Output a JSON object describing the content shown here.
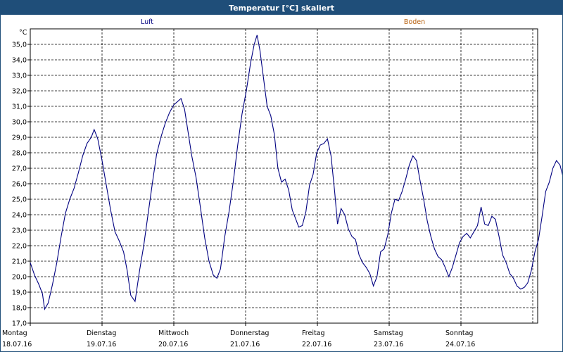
{
  "window": {
    "title": "Temperatur [°C] skaliert"
  },
  "chart_data": {
    "type": "line",
    "title": "Temperatur [°C] skaliert",
    "ylabel": "°C",
    "ylim": [
      17.0,
      36.0
    ],
    "grid": true,
    "y_ticks": [
      "17,0",
      "18,0",
      "19,0",
      "20,0",
      "21,0",
      "22,0",
      "23,0",
      "24,0",
      "25,0",
      "26,0",
      "27,0",
      "28,0",
      "29,0",
      "30,0",
      "31,0",
      "32,0",
      "33,0",
      "34,0",
      "35,0"
    ],
    "x_days": [
      {
        "day": "Montag",
        "date": "18.07.16"
      },
      {
        "day": "Dienstag",
        "date": "19.07.16"
      },
      {
        "day": "Mittwoch",
        "date": "20.07.16"
      },
      {
        "day": "Donnerstag",
        "date": "21.07.16"
      },
      {
        "day": "Freitag",
        "date": "22.07.16"
      },
      {
        "day": "Samstag",
        "date": "23.07.16"
      },
      {
        "day": "Sonntag",
        "date": "24.07.16"
      }
    ],
    "legend": [
      {
        "name": "Luft",
        "color": "#000080"
      },
      {
        "name": "Boden",
        "color": "#b8620f"
      }
    ],
    "series": [
      {
        "name": "Luft",
        "color": "#000080",
        "x_unit": "days since 18.07.16 00:00",
        "points": [
          [
            0.0,
            20.9
          ],
          [
            0.06,
            20.1
          ],
          [
            0.12,
            19.5
          ],
          [
            0.17,
            18.9
          ],
          [
            0.2,
            17.9
          ],
          [
            0.25,
            18.3
          ],
          [
            0.31,
            19.5
          ],
          [
            0.37,
            20.9
          ],
          [
            0.43,
            22.6
          ],
          [
            0.49,
            24.1
          ],
          [
            0.55,
            25.0
          ],
          [
            0.61,
            25.7
          ],
          [
            0.67,
            26.7
          ],
          [
            0.73,
            27.8
          ],
          [
            0.79,
            28.6
          ],
          [
            0.85,
            29.0
          ],
          [
            0.89,
            29.5
          ],
          [
            0.94,
            28.9
          ],
          [
            1.0,
            27.5
          ],
          [
            1.06,
            25.9
          ],
          [
            1.12,
            24.3
          ],
          [
            1.18,
            22.9
          ],
          [
            1.24,
            22.3
          ],
          [
            1.3,
            21.6
          ],
          [
            1.35,
            20.4
          ],
          [
            1.4,
            18.8
          ],
          [
            1.46,
            18.4
          ],
          [
            1.52,
            20.3
          ],
          [
            1.58,
            22.0
          ],
          [
            1.64,
            24.0
          ],
          [
            1.7,
            26.0
          ],
          [
            1.76,
            27.9
          ],
          [
            1.82,
            29.0
          ],
          [
            1.88,
            29.9
          ],
          [
            1.94,
            30.6
          ],
          [
            2.0,
            31.1
          ],
          [
            2.05,
            31.3
          ],
          [
            2.1,
            31.5
          ],
          [
            2.15,
            30.8
          ],
          [
            2.2,
            29.3
          ],
          [
            2.25,
            27.8
          ],
          [
            2.31,
            26.4
          ],
          [
            2.37,
            24.5
          ],
          [
            2.43,
            22.5
          ],
          [
            2.49,
            21.0
          ],
          [
            2.55,
            20.1
          ],
          [
            2.6,
            19.9
          ],
          [
            2.65,
            20.5
          ],
          [
            2.71,
            22.6
          ],
          [
            2.77,
            24.2
          ],
          [
            2.83,
            26.2
          ],
          [
            2.89,
            28.5
          ],
          [
            2.95,
            30.5
          ],
          [
            3.01,
            32.0
          ],
          [
            3.07,
            33.8
          ],
          [
            3.12,
            35.0
          ],
          [
            3.16,
            35.6
          ],
          [
            3.2,
            34.6
          ],
          [
            3.25,
            32.8
          ],
          [
            3.3,
            31.0
          ],
          [
            3.35,
            30.4
          ],
          [
            3.4,
            29.2
          ],
          [
            3.45,
            27.0
          ],
          [
            3.5,
            26.1
          ],
          [
            3.55,
            26.3
          ],
          [
            3.6,
            25.6
          ],
          [
            3.65,
            24.3
          ],
          [
            3.7,
            23.7
          ],
          [
            3.74,
            23.2
          ],
          [
            3.79,
            23.3
          ],
          [
            3.84,
            24.2
          ],
          [
            3.89,
            25.9
          ],
          [
            3.94,
            26.6
          ],
          [
            3.99,
            28.0
          ],
          [
            4.04,
            28.5
          ],
          [
            4.09,
            28.6
          ],
          [
            4.14,
            28.9
          ],
          [
            4.19,
            27.8
          ],
          [
            4.24,
            25.5
          ],
          [
            4.28,
            23.4
          ],
          [
            4.33,
            24.4
          ],
          [
            4.38,
            24.0
          ],
          [
            4.43,
            23.1
          ],
          [
            4.48,
            22.6
          ],
          [
            4.53,
            22.4
          ],
          [
            4.58,
            21.4
          ],
          [
            4.63,
            20.9
          ],
          [
            4.68,
            20.6
          ],
          [
            4.73,
            20.2
          ],
          [
            4.78,
            19.4
          ],
          [
            4.83,
            20.0
          ],
          [
            4.88,
            21.6
          ],
          [
            4.93,
            21.8
          ],
          [
            4.98,
            22.7
          ],
          [
            5.03,
            24.1
          ],
          [
            5.08,
            25.0
          ],
          [
            5.13,
            24.9
          ],
          [
            5.18,
            25.5
          ],
          [
            5.23,
            26.3
          ],
          [
            5.28,
            27.2
          ],
          [
            5.33,
            27.8
          ],
          [
            5.38,
            27.5
          ],
          [
            5.43,
            26.2
          ],
          [
            5.48,
            25.0
          ],
          [
            5.53,
            23.6
          ],
          [
            5.58,
            22.6
          ],
          [
            5.63,
            21.8
          ],
          [
            5.68,
            21.3
          ],
          [
            5.73,
            21.1
          ],
          [
            5.78,
            20.6
          ],
          [
            5.83,
            20.0
          ],
          [
            5.88,
            20.6
          ],
          [
            5.93,
            21.4
          ],
          [
            5.98,
            22.2
          ],
          [
            6.03,
            22.6
          ],
          [
            6.08,
            22.8
          ],
          [
            6.13,
            22.5
          ],
          [
            6.18,
            22.9
          ],
          [
            6.23,
            23.3
          ],
          [
            6.28,
            24.5
          ],
          [
            6.33,
            23.4
          ],
          [
            6.38,
            23.3
          ],
          [
            6.43,
            23.9
          ],
          [
            6.48,
            23.7
          ],
          [
            6.53,
            22.6
          ],
          [
            6.58,
            21.4
          ],
          [
            6.63,
            20.9
          ],
          [
            6.68,
            20.2
          ],
          [
            6.73,
            19.9
          ],
          [
            6.78,
            19.4
          ],
          [
            6.83,
            19.2
          ],
          [
            6.88,
            19.3
          ],
          [
            6.93,
            19.6
          ],
          [
            6.98,
            20.4
          ],
          [
            7.03,
            21.6
          ],
          [
            7.08,
            22.4
          ],
          [
            7.13,
            23.9
          ],
          [
            7.18,
            25.5
          ],
          [
            7.23,
            26.1
          ],
          [
            7.28,
            27.0
          ],
          [
            7.33,
            27.5
          ],
          [
            7.38,
            27.2
          ],
          [
            7.43,
            26.3
          ],
          [
            7.48,
            25.2
          ],
          [
            7.53,
            24.6
          ],
          [
            7.56,
            24.5
          ]
        ]
      }
    ]
  }
}
